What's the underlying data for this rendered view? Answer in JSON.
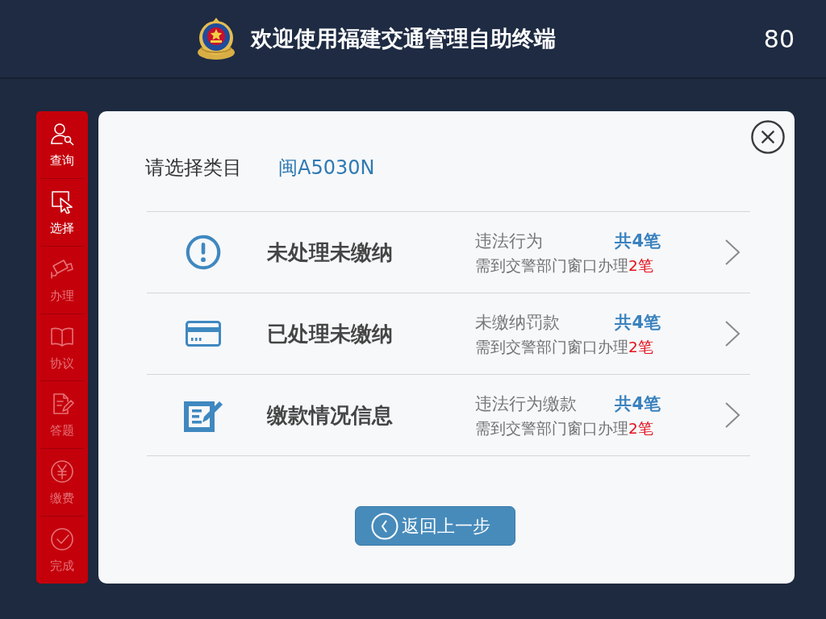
{
  "header": {
    "title": "欢迎使用福建交通管理自助终端",
    "countdown": "80"
  },
  "sidebar": {
    "items": [
      {
        "kind": "query",
        "label": "查询",
        "disabled": false
      },
      {
        "kind": "select",
        "label": "选择",
        "disabled": false
      },
      {
        "kind": "handle",
        "label": "办理",
        "disabled": true
      },
      {
        "kind": "agreement",
        "label": "协议",
        "disabled": true
      },
      {
        "kind": "quiz",
        "label": "答题",
        "disabled": true
      },
      {
        "kind": "payment",
        "label": "缴费",
        "disabled": true
      },
      {
        "kind": "complete",
        "label": "完成",
        "disabled": true
      }
    ]
  },
  "panel": {
    "prompt": "请选择类目",
    "plate": "闽A5030N",
    "categories": [
      {
        "kind": "alert",
        "title": "未处理未缴纳",
        "label": "违法行为",
        "total": "共4笔",
        "note": "需到交警部门窗口办理",
        "note_count": "2笔"
      },
      {
        "kind": "card",
        "title": "已处理未缴纳",
        "label": "未缴纳罚款",
        "total": "共4笔",
        "note": "需到交警部门窗口办理",
        "note_count": "2笔"
      },
      {
        "kind": "edit",
        "title": "缴款情况信息",
        "label": "违法行为缴款",
        "total": "共4笔",
        "note": "需到交警部门窗口办理",
        "note_count": "2笔"
      }
    ],
    "back_button": "返回上一步"
  }
}
